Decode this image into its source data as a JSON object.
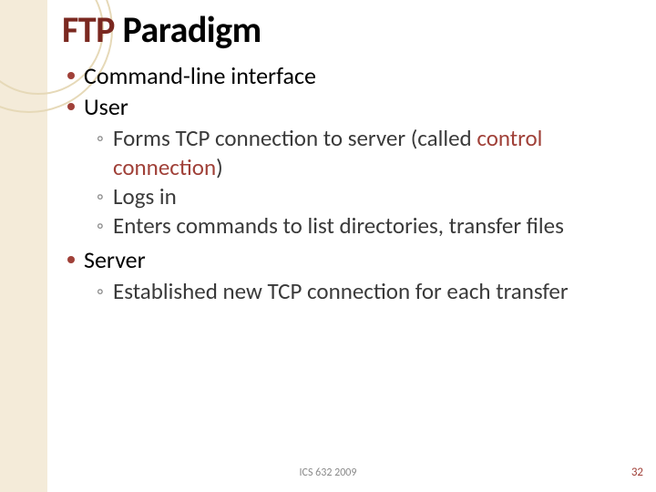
{
  "title_strong": "FTP",
  "title_rest": " Paradigm",
  "bullets": {
    "b0": "Command-line interface",
    "b1": "User",
    "b1_subs": {
      "s0_pre": "Forms TCP connection to server (called ",
      "s0_hl": "control connection",
      "s0_post": ")",
      "s1": "Logs in",
      "s2": "Enters commands to list directories, transfer files"
    },
    "b2": "Server",
    "b2_subs": {
      "s0": "Established new TCP connection for each transfer"
    }
  },
  "footer_center": "ICS 632 2009",
  "footer_right": "32"
}
